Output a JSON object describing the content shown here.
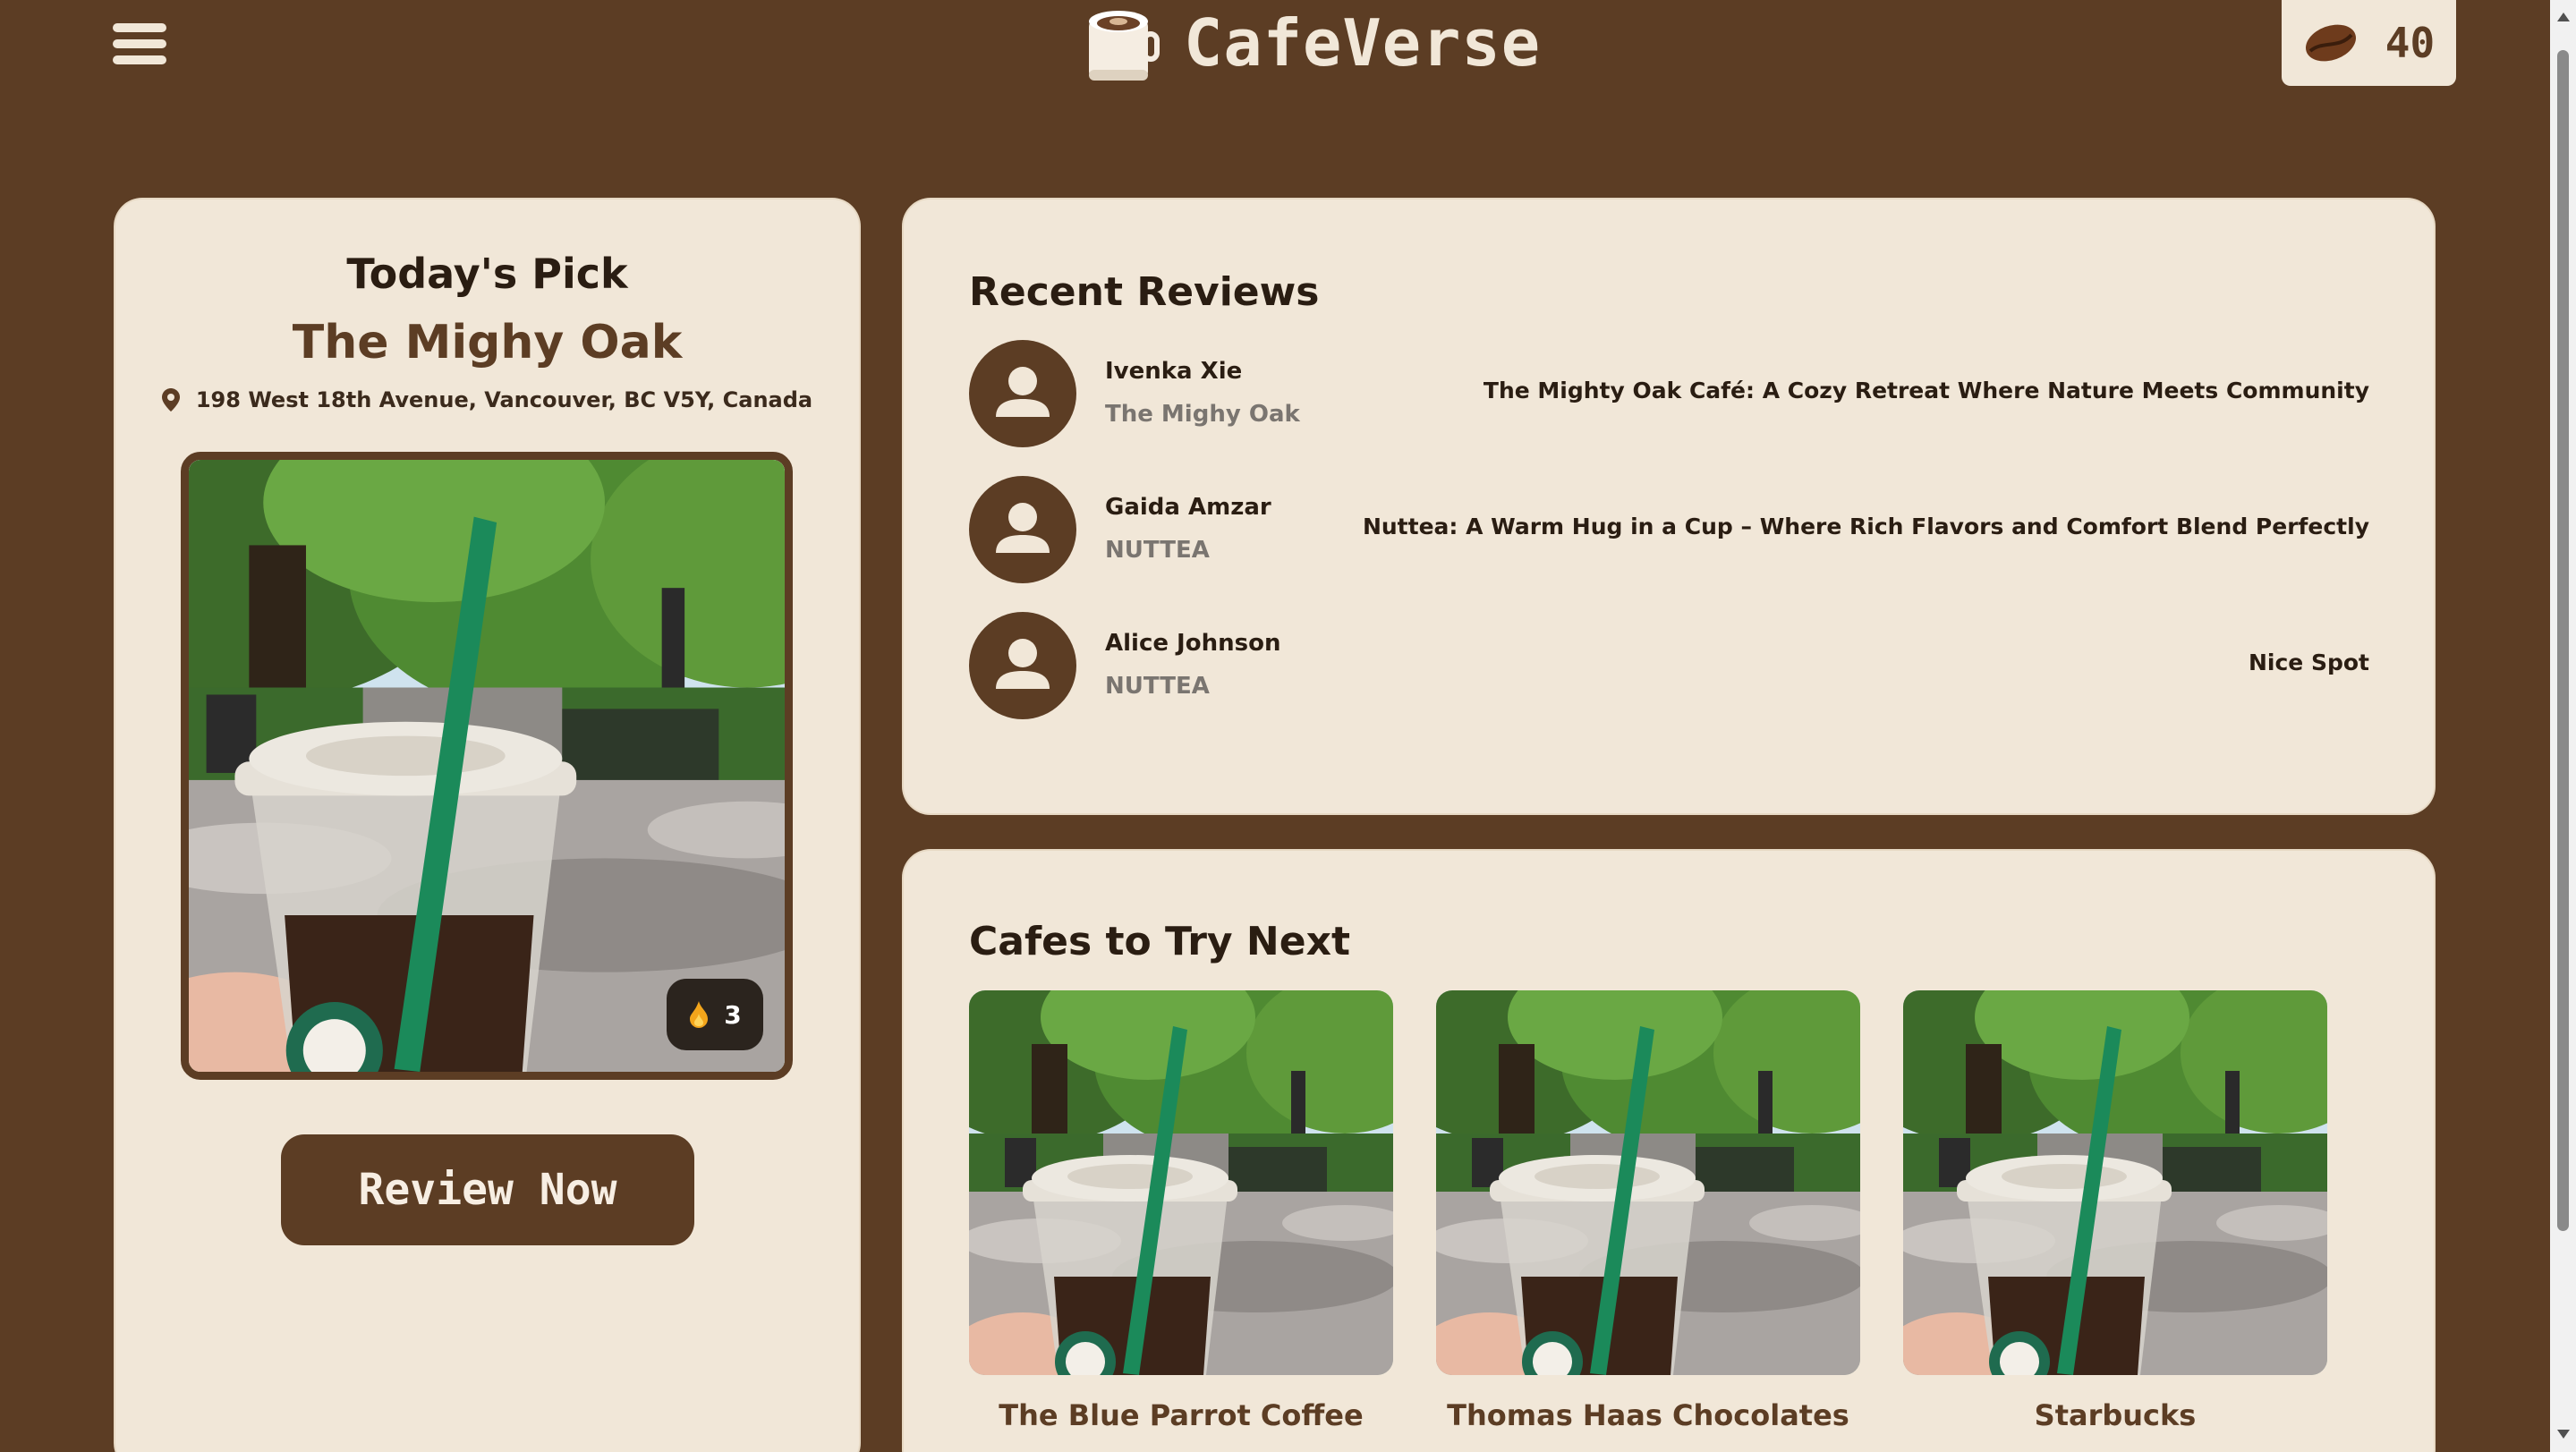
{
  "header": {
    "app_title": "CafeVerse",
    "bean_count": "40"
  },
  "todays_pick": {
    "heading": "Today's Pick",
    "cafe_name": "The Mighy Oak",
    "address": "198 West 18th Avenue, Vancouver, BC V5Y, Canada",
    "likes": "3",
    "review_button": "Review Now"
  },
  "recent_reviews": {
    "title": "Recent Reviews",
    "items": [
      {
        "reviewer": "Ivenka Xie",
        "cafe": "The Mighy Oak",
        "title": "The Mighty Oak Café: A Cozy Retreat Where Nature Meets Community"
      },
      {
        "reviewer": "Gaida Amzar",
        "cafe": "NUTTEA",
        "title": "Nuttea: A Warm Hug in a Cup – Where Rich Flavors and Comfort Blend Perfectly"
      },
      {
        "reviewer": "Alice Johnson",
        "cafe": "NUTTEA",
        "title": "Nice Spot"
      }
    ]
  },
  "cafes_next": {
    "title": "Cafes to Try Next",
    "items": [
      {
        "name": "The Blue Parrot Coffee"
      },
      {
        "name": "Thomas Haas Chocolates"
      },
      {
        "name": "Starbucks"
      }
    ]
  },
  "colors": {
    "background": "#5c3d24",
    "card": "#f1e7d8",
    "accent": "#5c3d24"
  }
}
